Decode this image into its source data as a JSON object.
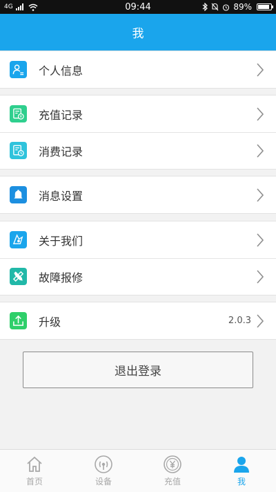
{
  "status_bar": {
    "signal": "4G",
    "time": "09:44",
    "battery": "89%",
    "battery_level": 0.89
  },
  "header": {
    "title": "我"
  },
  "menu": {
    "profile": {
      "label": "个人信息",
      "icon": "profile-icon",
      "color": "#1aa5ec"
    },
    "recharge_records": {
      "label": "充值记录",
      "icon": "recharge-record-icon",
      "color": "#2fcf8e"
    },
    "consumption_records": {
      "label": "消费记录",
      "icon": "consumption-record-icon",
      "color": "#2fc3dc"
    },
    "message_settings": {
      "label": "消息设置",
      "icon": "bell-icon",
      "color": "#1c8fe0"
    },
    "about_us": {
      "label": "关于我们",
      "icon": "about-icon",
      "color": "#1aa5ec"
    },
    "fault_repair": {
      "label": "故障报修",
      "icon": "wrench-icon",
      "color": "#21b8a8"
    },
    "upgrade": {
      "label": "升级",
      "value": "2.0.3",
      "icon": "upload-icon",
      "color": "#2fcf6a"
    }
  },
  "logout": {
    "label": "退出登录"
  },
  "tabs": [
    {
      "label": "首页",
      "icon": "home-icon",
      "active": false
    },
    {
      "label": "设备",
      "icon": "device-icon",
      "active": false
    },
    {
      "label": "充值",
      "icon": "yen-icon",
      "active": false
    },
    {
      "label": "我",
      "icon": "user-icon",
      "active": true
    }
  ],
  "colors": {
    "accent": "#1aa5ec",
    "tab_inactive": "#a8a8a8"
  }
}
